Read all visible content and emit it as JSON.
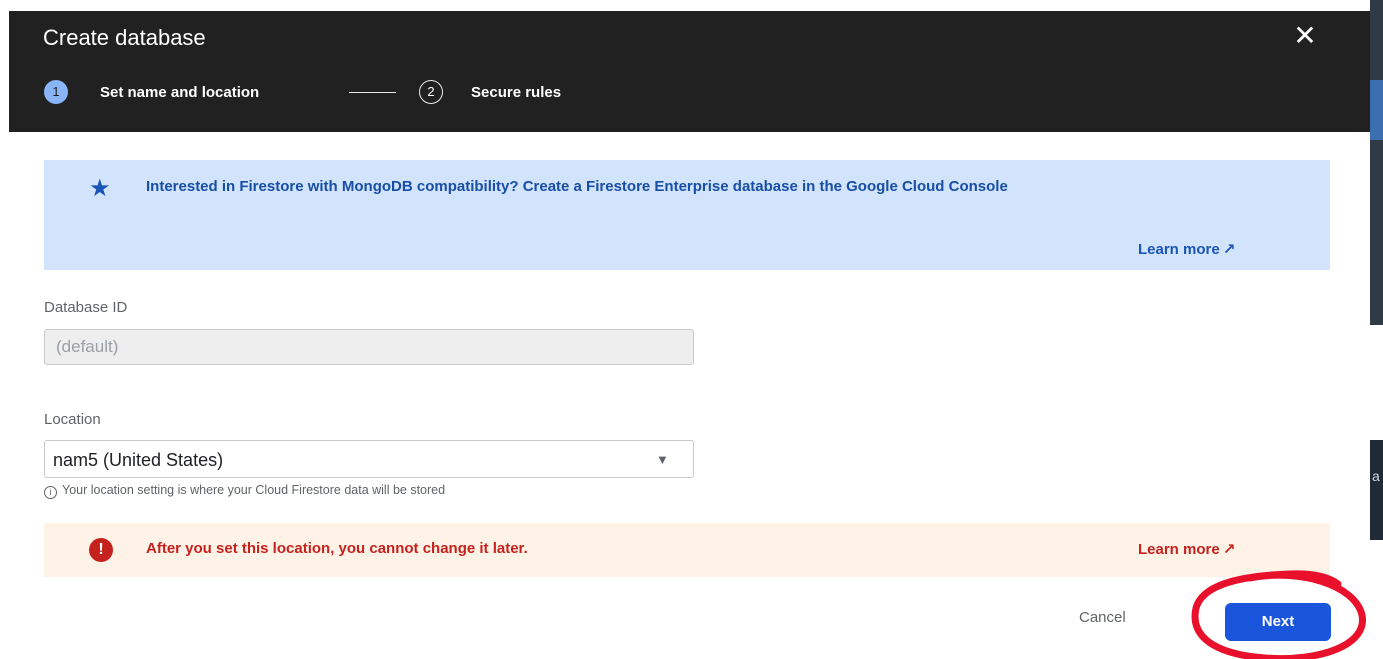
{
  "dialog": {
    "title": "Create database",
    "close_icon": "close-icon"
  },
  "stepper": {
    "steps": [
      {
        "number": "1",
        "label": "Set name and location",
        "state": "active"
      },
      {
        "number": "2",
        "label": "Secure rules",
        "state": "inactive"
      }
    ]
  },
  "info_banner": {
    "icon": "star-icon",
    "text": "Interested in Firestore with MongoDB compatibility? Create a Firestore Enterprise database in the Google Cloud Console",
    "link": "Learn more",
    "link_icon": "external-link-icon",
    "color": "#d2e3fc"
  },
  "database_id": {
    "label": "Database ID",
    "value": "(default)"
  },
  "location": {
    "label": "Location",
    "selected": "nam5 (United States)",
    "hint": "Your location setting is where your Cloud Firestore data will be stored"
  },
  "warning_banner": {
    "icon": "error-icon",
    "text": "After you set this location, you cannot change it later.",
    "link": "Learn more",
    "link_icon": "external-link-icon",
    "color": "#fef3e6"
  },
  "actions": {
    "cancel_label": "Cancel",
    "next_label": "Next",
    "accent": "#1a56db"
  },
  "annotation": {
    "shape": "red hand-drawn circle around Next button",
    "color": "#e8102a"
  }
}
